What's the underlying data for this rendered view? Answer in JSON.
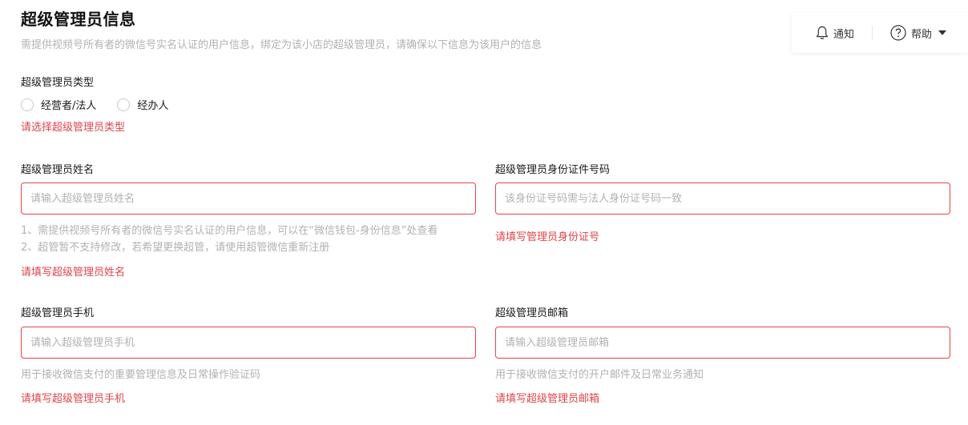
{
  "header": {
    "title": "超级管理员信息",
    "description": "需提供视频号所有者的微信号实名认证的用户信息，绑定为该小店的超级管理员，请确保以下信息为该用户的信息"
  },
  "topbar": {
    "notice_label": "通知",
    "help_label": "帮助"
  },
  "admin_type": {
    "label": "超级管理员类型",
    "options": [
      "经营者/法人",
      "经办人"
    ],
    "error": "请选择超级管理员类型"
  },
  "name": {
    "label": "超级管理员姓名",
    "placeholder": "请输入超级管理员姓名",
    "hints": [
      "1、需提供视频号所有者的微信号实名认证的用户信息，可以在“微信钱包-身份信息”处查看",
      "2、超管暂不支持修改，若希望更换超管，请使用超管微信重新注册"
    ],
    "error": "请填写超级管理员姓名"
  },
  "id_number": {
    "label": "超级管理员身份证件号码",
    "placeholder": "该身份证号码需与法人身份证号码一致",
    "error": "请填写管理员身份证号"
  },
  "phone": {
    "label": "超级管理员手机",
    "placeholder": "请输入超级管理员手机",
    "hint": "用于接收微信支付的重要管理信息及日常操作验证码",
    "error": "请填写超级管理员手机"
  },
  "email": {
    "label": "超级管理员邮箱",
    "placeholder": "请输入超级管理员邮箱",
    "hint": "用于接收微信支付的开户邮件及日常业务通知",
    "error": "请填写超级管理员邮箱"
  },
  "colors": {
    "error": "#e0454a",
    "hint": "#b2b2b2",
    "text": "#1a1a1a"
  }
}
